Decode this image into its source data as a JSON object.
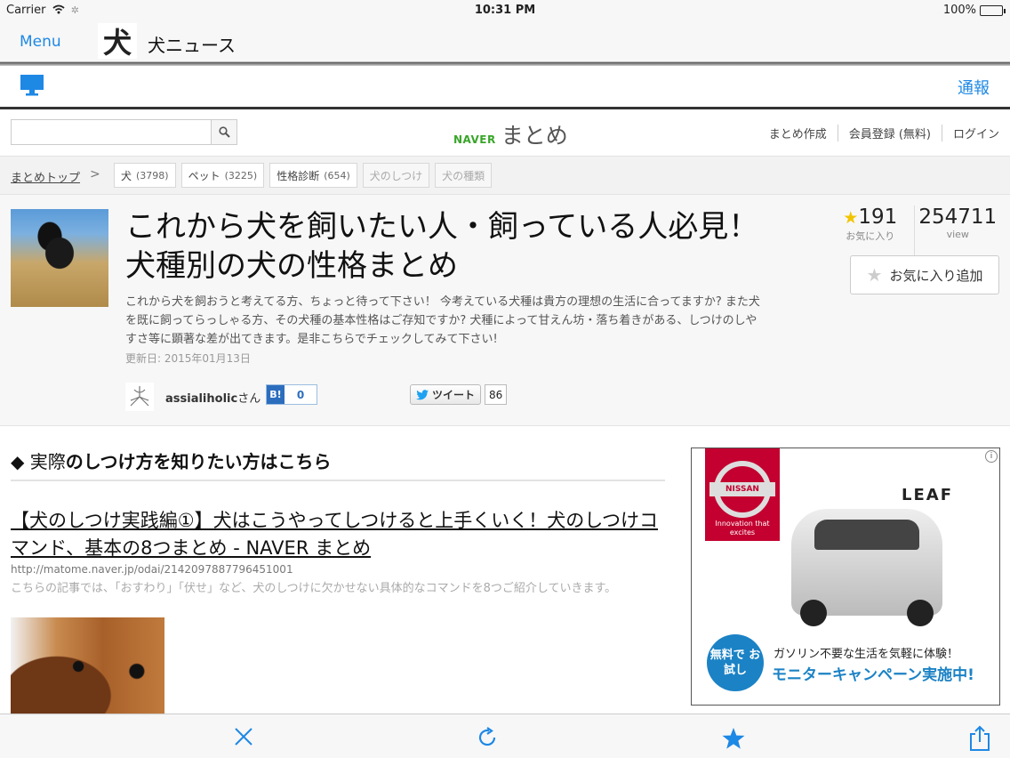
{
  "status": {
    "carrier": "Carrier",
    "time": "10:31 PM",
    "battery": "100%",
    "battery_level": 1.0
  },
  "app": {
    "menu": "Menu",
    "logo_char": "犬",
    "title": "犬ニュース",
    "report": "通報"
  },
  "naver": {
    "brand_small": "NAVER",
    "brand_large": "まとめ",
    "search": {
      "value": "",
      "placeholder": ""
    },
    "links": [
      "まとめ作成",
      "会員登録 (無料)",
      "ログイン"
    ]
  },
  "breadcrumb": {
    "top": "まとめトップ",
    "tags": [
      {
        "label": "犬",
        "count": "(3798)"
      },
      {
        "label": "ペット",
        "count": "(3225)"
      },
      {
        "label": "性格診断",
        "count": "(654)"
      },
      {
        "label": "犬のしつけ",
        "count": ""
      },
      {
        "label": "犬の種類",
        "count": ""
      }
    ]
  },
  "article": {
    "title": "これから犬を飼いたい人・飼っている人必見！ 犬種別の犬の性格まとめ",
    "description": "これから犬を飼おうと考えてる方、ちょっと待って下さい！ 今考えている犬種は貴方の理想の生活に合ってますか? また犬を既に飼ってらっしゃる方、その犬種の基本性格はご存知ですか? 犬種によって甘えん坊・落ち着きがある、しつけのしやすさ等に顕著な差が出てきます。是非こちらでチェックしてみて下さい!",
    "updated": "更新日: 2015年01月13日",
    "author_name": "assialiholic",
    "author_suffix": "さん",
    "hatena_label": "B!",
    "hatena_count": "0",
    "tweet_label": "ツイート",
    "tweet_count": "86",
    "fav_count": "191",
    "fav_label": "お気に入り",
    "view_count": "254711",
    "view_label": "view",
    "fav_button": "お気に入り追加"
  },
  "section": {
    "heading_prefix": "◆ 実際",
    "heading_rest": "のしつけ方を知りたい方はこちら",
    "link_title": "【犬のしつけ実践編①】犬はこうやってしつけると上手くいく！犬のしつけコマンド、基本の8つまとめ - NAVER まとめ",
    "link_url": "http://matome.naver.jp/odai/2142097887796451001",
    "link_desc": "こちらの記事では、「おすわり」「伏せ」など、犬のしつけに欠かせない具体的なコマンドを8つご紹介していきます。"
  },
  "ad": {
    "brand": "NISSAN",
    "tagline": "Innovation that excites",
    "model": "LEAF",
    "badge": "無料で お試し",
    "copy1": "ガソリン不要な生活を気軽に体験！",
    "copy2": "モニターキャンペーン実施中!"
  },
  "colors": {
    "accent": "#1e88e5",
    "naver_green": "#3aa52a",
    "nissan_red": "#c3002f"
  }
}
